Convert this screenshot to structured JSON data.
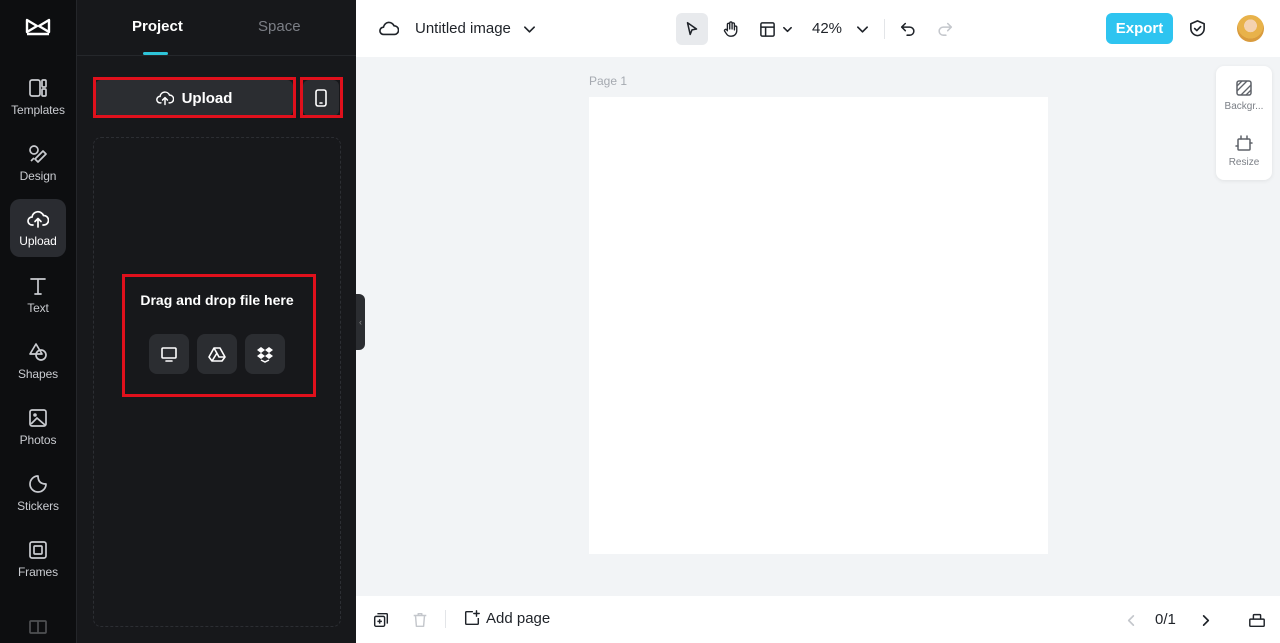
{
  "rail": {
    "items": [
      {
        "label": "Templates",
        "icon": "templates-icon"
      },
      {
        "label": "Design",
        "icon": "design-icon"
      },
      {
        "label": "Upload",
        "icon": "upload-icon",
        "active": true
      },
      {
        "label": "Text",
        "icon": "text-icon"
      },
      {
        "label": "Shapes",
        "icon": "shapes-icon"
      },
      {
        "label": "Photos",
        "icon": "photos-icon"
      },
      {
        "label": "Stickers",
        "icon": "stickers-icon"
      },
      {
        "label": "Frames",
        "icon": "frames-icon"
      }
    ]
  },
  "panel": {
    "tabs": [
      {
        "label": "Project",
        "active": true
      },
      {
        "label": "Space"
      }
    ],
    "upload_label": "Upload",
    "dropzone_text": "Drag and drop file here",
    "sources": [
      "computer-icon",
      "google-drive-icon",
      "dropbox-icon"
    ]
  },
  "topbar": {
    "title": "Untitled image",
    "zoom": "42%",
    "export_label": "Export"
  },
  "canvas": {
    "page_label": "Page 1"
  },
  "side_tools": [
    {
      "label": "Backgr...",
      "icon": "background-icon"
    },
    {
      "label": "Resize",
      "icon": "resize-icon"
    }
  ],
  "bottombar": {
    "add_page_label": "Add page",
    "page_count": "0/1"
  },
  "colors": {
    "accent": "#2ec4f0",
    "highlight": "#e0101c",
    "rail_bg": "#0d0e10",
    "panel_bg": "#17181b"
  }
}
